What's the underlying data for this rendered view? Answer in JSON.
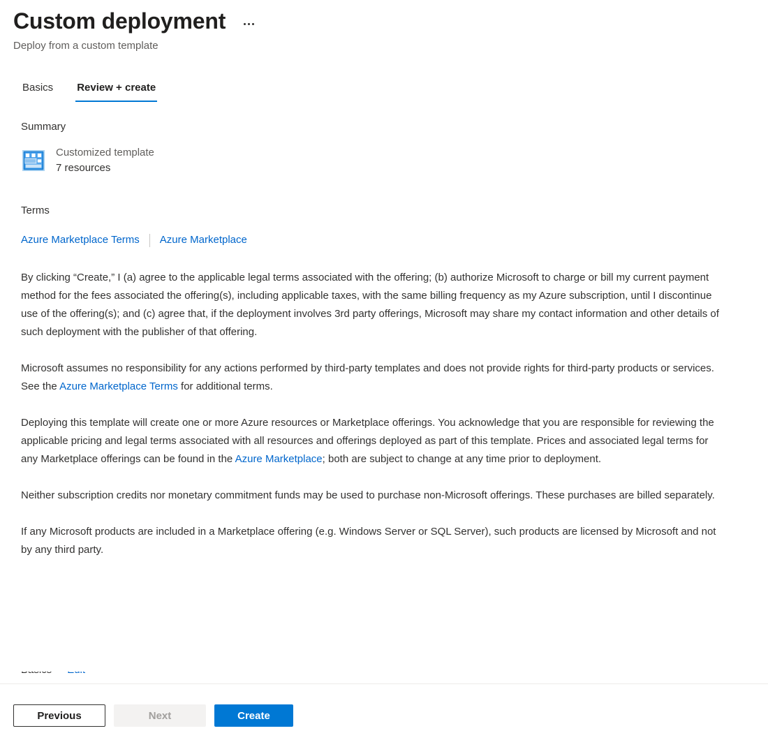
{
  "header": {
    "title": "Custom deployment",
    "subtitle": "Deploy from a custom template",
    "overflow_menu_label": "More",
    "overflow_icon": "ellipsis-icon"
  },
  "tabs": [
    {
      "label": "Basics",
      "active": false
    },
    {
      "label": "Review + create",
      "active": true
    }
  ],
  "summary": {
    "heading": "Summary",
    "icon": "template-grid-icon",
    "template_name": "Customized template",
    "resource_count": "7 resources"
  },
  "terms": {
    "heading": "Terms",
    "links": [
      {
        "label": "Azure Marketplace Terms"
      },
      {
        "label": "Azure Marketplace"
      }
    ],
    "paragraphs": [
      {
        "id": "p1",
        "segments": [
          {
            "type": "text",
            "value": "By clicking “Create,” I (a) agree to the applicable legal terms associated with the offering; (b) authorize Microsoft to charge or bill my current payment method for the fees associated the offering(s), including applicable taxes, with the same billing frequency as my Azure subscription, until I discontinue use of the offering(s); and (c) agree that, if the deployment involves 3rd party offerings, Microsoft may share my contact information and other details of such deployment with the publisher of that offering."
          }
        ]
      },
      {
        "id": "p2",
        "segments": [
          {
            "type": "text",
            "value": "Microsoft assumes no responsibility for any actions performed by third-party templates and does not provide rights for third-party products or services. See the "
          },
          {
            "type": "link",
            "value": "Azure Marketplace Terms"
          },
          {
            "type": "text",
            "value": " for additional terms."
          }
        ]
      },
      {
        "id": "p3",
        "segments": [
          {
            "type": "text",
            "value": "Deploying this template will create one or more Azure resources or Marketplace offerings.  You acknowledge that you are responsible for reviewing the applicable pricing and legal terms associated with all resources and offerings deployed as part of this template.  Prices and associated legal terms for any Marketplace offerings can be found in the "
          },
          {
            "type": "link",
            "value": "Azure Marketplace"
          },
          {
            "type": "text",
            "value": "; both are subject to change at any time prior to deployment."
          }
        ]
      },
      {
        "id": "p4",
        "segments": [
          {
            "type": "text",
            "value": "Neither subscription credits nor monetary commitment funds may be used to purchase non-Microsoft offerings. These purchases are billed separately."
          }
        ]
      },
      {
        "id": "p5",
        "segments": [
          {
            "type": "text",
            "value": "If any Microsoft products are included in a Marketplace offering (e.g. Windows Server or SQL Server), such products are licensed by Microsoft and not by any third party."
          }
        ]
      }
    ]
  },
  "clipped": {
    "heading": "Basics",
    "link": "Edit"
  },
  "footer": {
    "previous_label": "Previous",
    "next_label": "Next",
    "create_label": "Create"
  },
  "colors": {
    "accent": "#0078d4",
    "link": "#0066cc",
    "text": "#323130",
    "muted": "#605e5c",
    "divider": "#edebe9",
    "disabled_bg": "#f3f2f1",
    "disabled_text": "#a19f9d"
  }
}
